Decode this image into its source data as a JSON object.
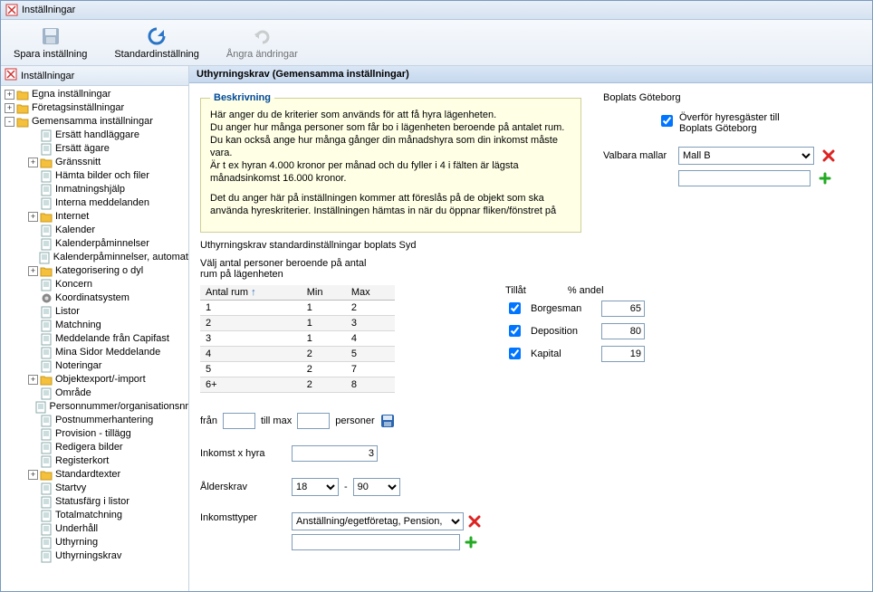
{
  "window": {
    "title": "Inställningar"
  },
  "toolbar": {
    "save": "Spara inställning",
    "default": "Standardinställning",
    "undo": "Ångra ändringar"
  },
  "sidebar": {
    "header": "Inställningar",
    "groups": [
      {
        "label": "Egna inställningar",
        "pm": "+"
      },
      {
        "label": "Företagsinställningar",
        "pm": "+"
      },
      {
        "label": "Gemensamma inställningar",
        "pm": "-"
      }
    ],
    "items": [
      {
        "label": "Ersätt handläggare",
        "icon": "page",
        "indent": 2
      },
      {
        "label": "Ersätt ägare",
        "icon": "page",
        "indent": 2
      },
      {
        "label": "Gränssnitt",
        "icon": "folder",
        "indent": 2,
        "pm": "+"
      },
      {
        "label": "Hämta bilder och filer",
        "icon": "page",
        "indent": 2
      },
      {
        "label": "Inmatningshjälp",
        "icon": "page",
        "indent": 2
      },
      {
        "label": "Interna meddelanden",
        "icon": "page",
        "indent": 2
      },
      {
        "label": "Internet",
        "icon": "folder",
        "indent": 2,
        "pm": "+"
      },
      {
        "label": "Kalender",
        "icon": "page",
        "indent": 2
      },
      {
        "label": "Kalenderpåminnelser",
        "icon": "page",
        "indent": 2
      },
      {
        "label": "Kalenderpåminnelser, automat",
        "icon": "page",
        "indent": 2
      },
      {
        "label": "Kategorisering o dyl",
        "icon": "folder",
        "indent": 2,
        "pm": "+"
      },
      {
        "label": "Koncern",
        "icon": "page",
        "indent": 2
      },
      {
        "label": "Koordinatsystem",
        "icon": "gear",
        "indent": 2
      },
      {
        "label": "Listor",
        "icon": "page",
        "indent": 2
      },
      {
        "label": "Matchning",
        "icon": "page",
        "indent": 2
      },
      {
        "label": "Meddelande från Capifast",
        "icon": "page",
        "indent": 2
      },
      {
        "label": "Mina Sidor Meddelande",
        "icon": "page",
        "indent": 2
      },
      {
        "label": "Noteringar",
        "icon": "page",
        "indent": 2
      },
      {
        "label": "Objektexport/-import",
        "icon": "folder",
        "indent": 2,
        "pm": "+"
      },
      {
        "label": "Område",
        "icon": "page",
        "indent": 2
      },
      {
        "label": "Personnummer/organisationsnr",
        "icon": "page",
        "indent": 2
      },
      {
        "label": "Postnummerhantering",
        "icon": "page",
        "indent": 2
      },
      {
        "label": "Provision - tillägg",
        "icon": "page",
        "indent": 2
      },
      {
        "label": "Redigera bilder",
        "icon": "page",
        "indent": 2
      },
      {
        "label": "Registerkort",
        "icon": "page",
        "indent": 2
      },
      {
        "label": "Standardtexter",
        "icon": "folder",
        "indent": 2,
        "pm": "+"
      },
      {
        "label": "Startvy",
        "icon": "page",
        "indent": 2
      },
      {
        "label": "Statusfärg i listor",
        "icon": "page",
        "indent": 2
      },
      {
        "label": "Totalmatchning",
        "icon": "page",
        "indent": 2
      },
      {
        "label": "Underhåll",
        "icon": "page",
        "indent": 2
      },
      {
        "label": "Uthyrning",
        "icon": "page",
        "indent": 2
      },
      {
        "label": "Uthyrningskrav",
        "icon": "page",
        "indent": 2
      }
    ]
  },
  "page": {
    "title": "Uthyrningskrav (Gemensamma inställningar)",
    "desc_legend": "Beskrivning",
    "desc_p1": "Här anger du de kriterier som används för att få hyra lägenheten.\nDu anger hur många personer som får bo i lägenheten beroende på antalet rum. Du kan också ange hur många gånger din månadshyra som din inkomst måste vara.\nÄr t ex hyran 4.000 kronor per månad och du fyller i 4 i fälten är lägsta månadsinkomst 16.000 kronor.",
    "desc_p2": "Det du anger här på inställningen kommer att föreslås på de objekt som ska använda hyreskriterier. Inställningen hämtas in när du öppnar fliken/fönstret på",
    "subhead": "Uthyrningskrav standardinställningar boplats Syd",
    "grid_label": "Välj antal personer beroende på antal rum på lägenheten",
    "grid_headers": {
      "rooms": "Antal rum",
      "min": "Min",
      "max": "Max"
    },
    "grid_rows": [
      {
        "rooms": "1",
        "min": "1",
        "max": "2"
      },
      {
        "rooms": "2",
        "min": "1",
        "max": "3"
      },
      {
        "rooms": "3",
        "min": "1",
        "max": "4"
      },
      {
        "rooms": "4",
        "min": "2",
        "max": "5"
      },
      {
        "rooms": "5",
        "min": "2",
        "max": "7"
      },
      {
        "rooms": "6+",
        "min": "2",
        "max": "8"
      }
    ],
    "range": {
      "from": "från",
      "tomax": "till max",
      "persons": "personer",
      "from_val": "",
      "tomax_val": ""
    },
    "income_label": "Inkomst x hyra",
    "income_val": "3",
    "age_label": "Ålderskrav",
    "age_from": "18",
    "age_to": "90",
    "age_dash": "-",
    "inctype_label": "Inkomsttyper",
    "inctype_sel": "Anställning/egetföretag, Pension,",
    "tillat": {
      "head": "Tillåt",
      "pct_head": "% andel",
      "rows": [
        {
          "label": "Borgesman",
          "pct": "65"
        },
        {
          "label": "Deposition",
          "pct": "80"
        },
        {
          "label": "Kapital",
          "pct": "19"
        }
      ]
    }
  },
  "right": {
    "title": "Boplats Göteborg",
    "cb_label": "Överför hyresgäster till Boplats Göteborg",
    "vm_label": "Valbara mallar",
    "vm_sel": "Mall B"
  }
}
